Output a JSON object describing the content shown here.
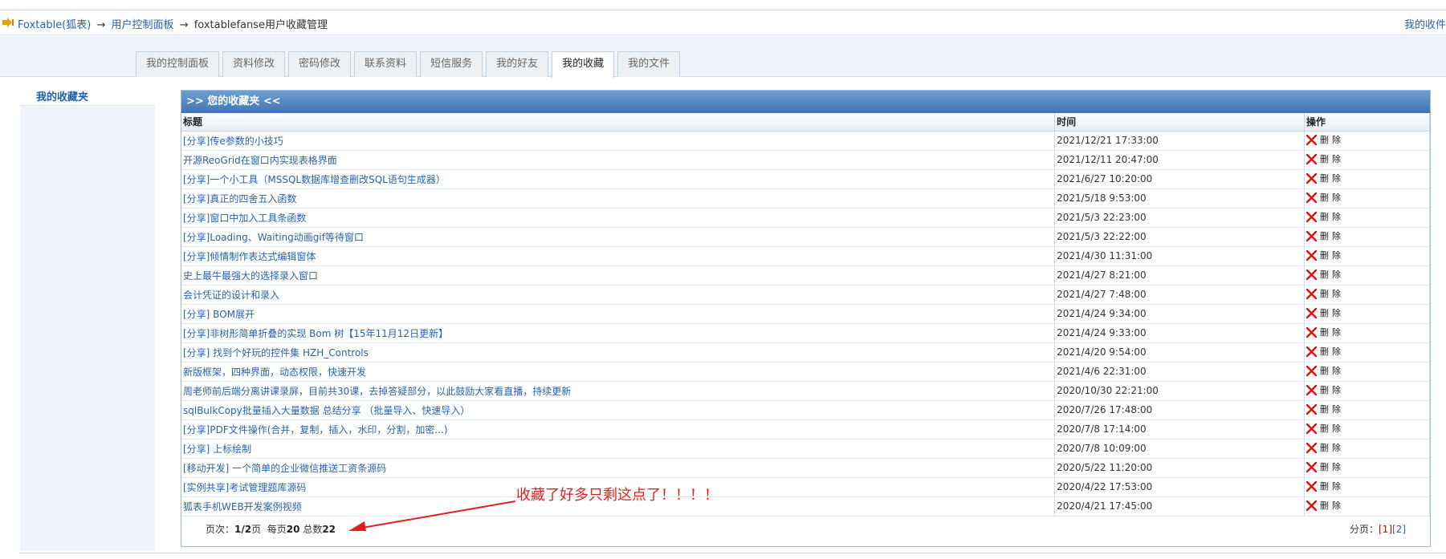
{
  "breadcrumb": {
    "items": [
      "Foxtable(狐表)",
      "用户控制面板"
    ],
    "separator": "→",
    "current": "foxtablefanse用户收藏管理",
    "right_link": "我的收件"
  },
  "tabs": [
    {
      "label": "我的控制面板"
    },
    {
      "label": "资料修改"
    },
    {
      "label": "密码修改"
    },
    {
      "label": "联系资料"
    },
    {
      "label": "短信服务"
    },
    {
      "label": "我的好友"
    },
    {
      "label": "我的收藏",
      "active": true
    },
    {
      "label": "我的文件"
    }
  ],
  "sidebar": {
    "items": [
      {
        "label": "我的收藏夹"
      }
    ]
  },
  "favorites": {
    "header": ">> 您的收藏夹 <<",
    "columns": {
      "title": "标题",
      "time": "时间",
      "ops": "操作"
    },
    "delete_label": "删除",
    "rows": [
      {
        "title": "[分享]传e参数的小技巧",
        "time": "2021/12/21 17:33:00"
      },
      {
        "title": "开源ReoGrid在窗口内实现表格界面",
        "time": "2021/12/11 20:47:00"
      },
      {
        "title": "[分享]一个小工具（MSSQL数据库增查删改SQL语句生成器）",
        "time": "2021/6/27 10:20:00"
      },
      {
        "title": "[分享]真正的四舍五入函数",
        "time": "2021/5/18 9:53:00"
      },
      {
        "title": "[分享]窗口中加入工具条函数",
        "time": "2021/5/3 22:23:00"
      },
      {
        "title": "[分享]Loading、Waiting动画gif等待窗口",
        "time": "2021/5/3 22:22:00"
      },
      {
        "title": "[分享]倾情制作表达式编辑窗体",
        "time": "2021/4/30 11:31:00"
      },
      {
        "title": "史上最牛最强大的选择录入窗口",
        "time": "2021/4/27 8:21:00"
      },
      {
        "title": "会计凭证的设计和录入",
        "time": "2021/4/27 7:48:00"
      },
      {
        "title": "[分享] BOM展开",
        "time": "2021/4/24 9:34:00"
      },
      {
        "title": "[分享]非树形简单折叠的实现 Bom 树【15年11月12日更新】",
        "time": "2021/4/24 9:33:00"
      },
      {
        "title": "[分享] 找到个好玩的控件集 HZH_Controls",
        "time": "2021/4/20 9:54:00"
      },
      {
        "title": "新版框架，四种界面，动态权限，快速开发",
        "time": "2021/4/6 22:31:00"
      },
      {
        "title": "周老师前后端分离讲课录屏，目前共30课，去掉答疑部分，以此鼓励大家看直播，持续更新",
        "time": "2020/10/30 22:21:00"
      },
      {
        "title": "sqlBulkCopy批量插入大量数据 总结分享 （批量导入、快速导入）",
        "time": "2020/7/26 17:48:00"
      },
      {
        "title": "[分享]PDF文件操作(合并，复制，插入，水印，分割，加密...)",
        "time": "2020/7/8 17:14:00"
      },
      {
        "title": "[分享] 上标绘制",
        "time": "2020/7/8 10:09:00"
      },
      {
        "title": "[移动开发] 一个简单的企业微信推送工资条源码",
        "time": "2020/5/22 11:20:00"
      },
      {
        "title": "[实例共享]考试管理题库源码",
        "time": "2020/4/22 17:53:00"
      },
      {
        "title": "狐表手机WEB开发案例视频",
        "time": "2020/4/21 17:45:00"
      }
    ]
  },
  "pager": {
    "label_page": "页次：",
    "page_value": "1/2",
    "label_page_unit": "页",
    "label_per": "每页",
    "per_page": "20",
    "label_total": "总数",
    "total": "22",
    "right_label": "分页：",
    "current_link": "[1]",
    "next_link": "[2]"
  },
  "annotation": {
    "text": "收藏了好多只剩这点了！！！！"
  },
  "icons": {
    "breadcrumb": "arrow-icon",
    "delete": "red-x-icon"
  },
  "colors": {
    "link": "#2a63a6",
    "header_bar": "#4a7fbb",
    "annotation": "#e02020"
  }
}
